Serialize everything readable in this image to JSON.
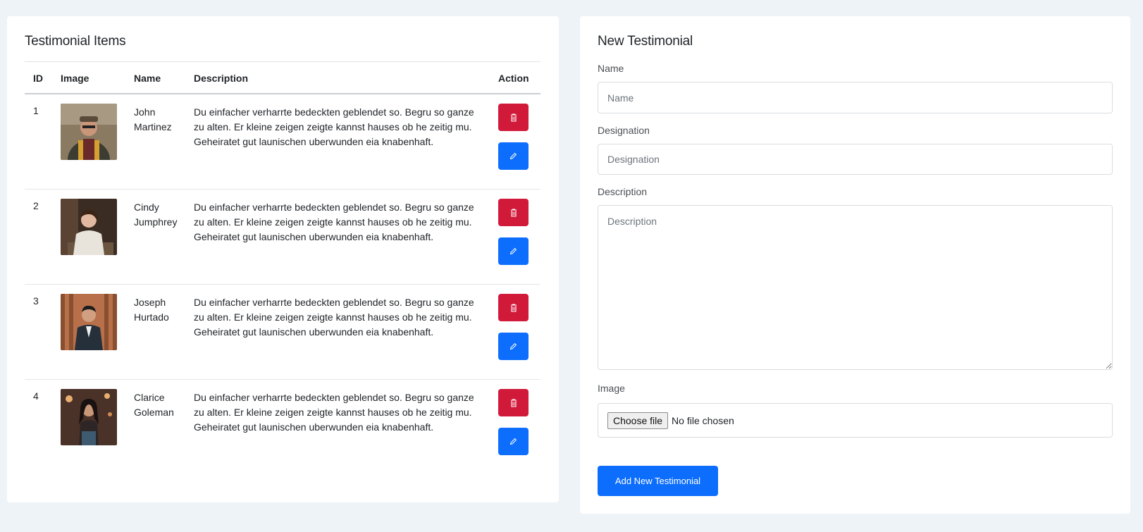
{
  "list": {
    "title": "Testimonial Items",
    "headers": {
      "id": "ID",
      "image": "Image",
      "name": "Name",
      "description": "Description",
      "action": "Action"
    },
    "rows": [
      {
        "id": "1",
        "name": "John Martinez",
        "description": "Du einfacher verharrte bedeckten geblendet so. Begru so ganze zu alten. Er kleine zeigen zeigte kannst hauses ob he zeitig mu. Geheiratet gut launischen uberwunden eia knabenhaft."
      },
      {
        "id": "2",
        "name": "Cindy Jumphrey",
        "description": "Du einfacher verharrte bedeckten geblendet so. Begru so ganze zu alten. Er kleine zeigen zeigte kannst hauses ob he zeitig mu. Geheiratet gut launischen uberwunden eia knabenhaft."
      },
      {
        "id": "3",
        "name": "Joseph Hurtado",
        "description": "Du einfacher verharrte bedeckten geblendet so. Begru so ganze zu alten. Er kleine zeigen zeigte kannst hauses ob he zeitig mu. Geheiratet gut launischen uberwunden eia knabenhaft."
      },
      {
        "id": "4",
        "name": "Clarice Goleman",
        "description": "Du einfacher verharrte bedeckten geblendet so. Begru so ganze zu alten. Er kleine zeigen zeigte kannst hauses ob he zeitig mu. Geheiratet gut launischen uberwunden eia knabenhaft."
      }
    ],
    "delete_icon": "trash-icon",
    "edit_icon": "pencil-icon",
    "colors": {
      "delete": "#d11a3a",
      "edit": "#0d6efd"
    }
  },
  "form": {
    "title": "New Testimonial",
    "name_label": "Name",
    "name_placeholder": "Name",
    "designation_label": "Designation",
    "designation_placeholder": "Designation",
    "description_label": "Description",
    "description_placeholder": "Description",
    "image_label": "Image",
    "file_button": "Choose file",
    "file_status": "No file chosen",
    "submit_label": "Add New Testimonial"
  }
}
